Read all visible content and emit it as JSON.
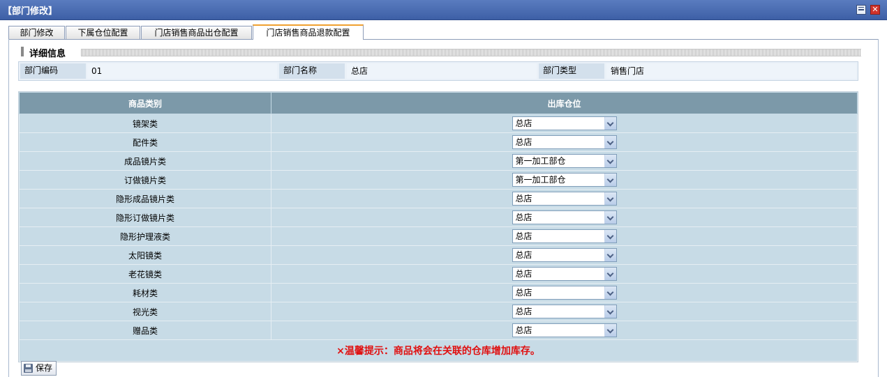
{
  "window": {
    "title": "【部门修改】",
    "close_glyph": "✕"
  },
  "tabs": [
    {
      "label": "部门修改",
      "active": false
    },
    {
      "label": "下属仓位配置",
      "active": false
    },
    {
      "label": "门店销售商品出仓配置",
      "active": false
    },
    {
      "label": "门店销售商品退款配置",
      "active": true
    }
  ],
  "section": {
    "title": "详细信息"
  },
  "info": {
    "code_label": "部门编码",
    "code_value": "01",
    "name_label": "部门名称",
    "name_value": "总店",
    "type_label": "部门类型",
    "type_value": "销售门店"
  },
  "table": {
    "headers": {
      "category": "商品类别",
      "warehouse": "出库仓位"
    },
    "rows": [
      {
        "category": "镜架类",
        "warehouse": "总店"
      },
      {
        "category": "配件类",
        "warehouse": "总店"
      },
      {
        "category": "成品镜片类",
        "warehouse": "第一加工部仓"
      },
      {
        "category": "订做镜片类",
        "warehouse": "第一加工部仓"
      },
      {
        "category": "隐形成品镜片类",
        "warehouse": "总店"
      },
      {
        "category": "隐形订做镜片类",
        "warehouse": "总店"
      },
      {
        "category": "隐形护理液类",
        "warehouse": "总店"
      },
      {
        "category": "太阳镜类",
        "warehouse": "总店"
      },
      {
        "category": "老花镜类",
        "warehouse": "总店"
      },
      {
        "category": "耗材类",
        "warehouse": "总店"
      },
      {
        "category": "视光类",
        "warehouse": "总店"
      },
      {
        "category": "赠品类",
        "warehouse": "总店"
      }
    ],
    "tip": "×温馨提示：商品将会在关联的仓库增加库存。"
  },
  "toolbar": {
    "save_label": "保存"
  },
  "colors": {
    "titlebar": "#3d5fa6",
    "header": "#7c99a9",
    "row": "#c7dbe6",
    "tip": "#e01010",
    "active_tab": "#f0a030"
  }
}
